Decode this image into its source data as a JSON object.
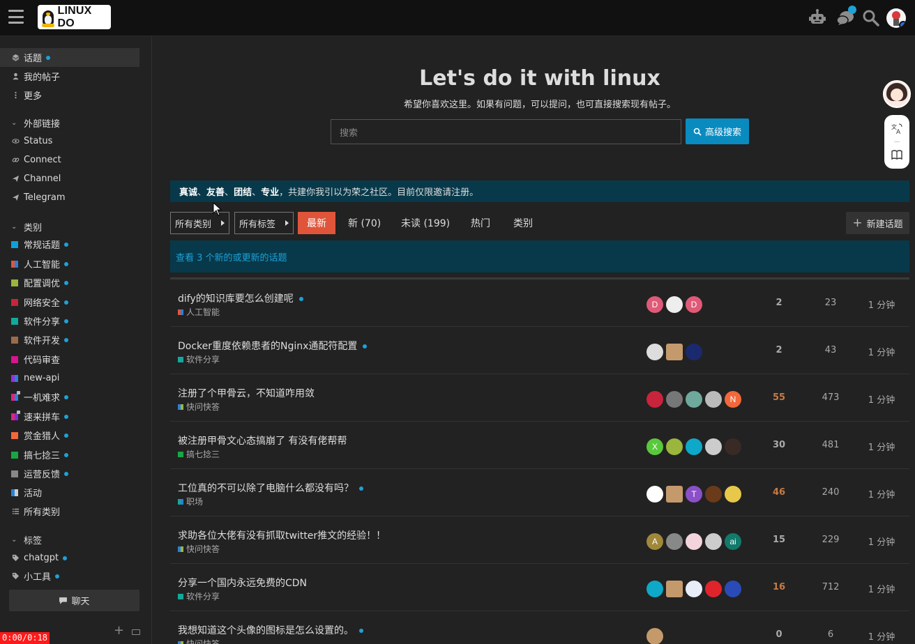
{
  "header": {
    "logo_text": "LINUX DO",
    "icons": [
      "hamburger-menu-icon",
      "robot-icon",
      "chat-bubbles-icon",
      "search-icon",
      "user-avatar"
    ],
    "accent": "#1ea1d8"
  },
  "sidebar": {
    "top_items": [
      {
        "label": "话题",
        "icon": "layers-icon",
        "dot": true,
        "active": true
      },
      {
        "label": "我的帖子",
        "icon": "user-icon",
        "dot": false
      },
      {
        "label": "更多",
        "icon": "more-vertical-icon",
        "dot": false
      }
    ],
    "external_title": "外部链接",
    "external_links": [
      {
        "label": "Status",
        "icon": "eye-icon"
      },
      {
        "label": "Connect",
        "icon": "link-icon"
      },
      {
        "label": "Channel",
        "icon": "send-icon"
      },
      {
        "label": "Telegram",
        "icon": "send-icon"
      }
    ],
    "categories_title": "类别",
    "categories": [
      {
        "label": "常规话题",
        "color": "#0e9fd8",
        "color2": "#0e9fd8",
        "dot": true
      },
      {
        "label": "人工智能",
        "color": "#e0553a",
        "color2": "#2c7fd8",
        "dot": true
      },
      {
        "label": "配置调优",
        "color": "#9ab63c",
        "color2": "#9ab63c",
        "dot": true
      },
      {
        "label": "网络安全",
        "color": "#c8243b",
        "color2": "#c8243b",
        "dot": true
      },
      {
        "label": "软件分享",
        "color": "#12a89d",
        "color2": "#12a89d",
        "dot": true
      },
      {
        "label": "软件开发",
        "color": "#9b6c4a",
        "color2": "#9b6c4a",
        "dot": true
      },
      {
        "label": "代码审查",
        "color": "#d8148f",
        "color2": "#d8148f",
        "dot": false
      },
      {
        "label": "new-api",
        "color": "#9b2fd8",
        "color2": "#2c7fd8",
        "dot": false
      },
      {
        "label": "一机难求",
        "color": "#e0247b",
        "color2": "#2c7fd8",
        "dot": true,
        "lock": true
      },
      {
        "label": "速来拼车",
        "color": "#e0247b",
        "color2": "#7b2fd8",
        "dot": true,
        "lock": true
      },
      {
        "label": "赏金猎人",
        "color": "#f2683a",
        "color2": "#f2683a",
        "dot": true
      },
      {
        "label": "搞七捻三",
        "color": "#17a844",
        "color2": "#17a844",
        "dot": true
      },
      {
        "label": "运营反馈",
        "color": "#888888",
        "color2": "#888888",
        "dot": true
      },
      {
        "label": "活动",
        "color": "#2c7fd8",
        "color2": "#cccccc",
        "dot": false
      },
      {
        "label": "所有类别",
        "color": "",
        "color2": "",
        "dot": false,
        "list": true
      }
    ],
    "tags_title": "标签",
    "tags": [
      {
        "label": "chatgpt",
        "dot": true
      },
      {
        "label": "小工具",
        "dot": true
      }
    ],
    "chat_label": "聊天",
    "timer": "0:00/0:18"
  },
  "hero": {
    "title": "Let's do it with linux",
    "subtitle": "希望你喜欢这里。如果有问题，可以提问，也可直接搜索现有帖子。",
    "search_placeholder": "搜索",
    "advanced_search": "高级搜索"
  },
  "banner": {
    "bold1": "真诚",
    "sep1": "、",
    "bold2": "友善",
    "sep2": "、",
    "bold3": "团结",
    "sep3": "、",
    "bold4": "专业",
    "rest": "，共建你我引以为荣之社区。目前仅限邀请注册。"
  },
  "nav": {
    "all_categories": "所有类别",
    "all_tags": "所有标签",
    "tabs": [
      "最新",
      "新 (70)",
      "未读 (199)",
      "热门",
      "类别"
    ],
    "new_topic": "新建话题"
  },
  "updates_text": "查看 3 个新的或更新的话题",
  "topics": [
    {
      "title": "dify的知识库要怎么创建呢",
      "unread": true,
      "category": "人工智能",
      "cat_color": "#e0553a",
      "cat_color2": "#2c7fd8",
      "posters": [
        {
          "letter": "D",
          "color": "#e05a78"
        },
        {
          "letter": "",
          "color": "#eeeeee"
        },
        {
          "letter": "D",
          "color": "#e05a78"
        }
      ],
      "replies": "2",
      "hot": false,
      "views": "23",
      "activity": "1 分钟"
    },
    {
      "title": "Docker重度依赖患者的Nginx通配符配置",
      "unread": true,
      "category": "软件分享",
      "cat_color": "#12a89d",
      "cat_color2": "#12a89d",
      "posters": [
        {
          "letter": "",
          "color": "#dddddd"
        },
        {
          "letter": "",
          "color": "#c49a6c",
          "square": true
        },
        {
          "letter": "",
          "color": "#1b2a6e"
        }
      ],
      "replies": "2",
      "hot": false,
      "views": "43",
      "activity": "1 分钟"
    },
    {
      "title": "注册了个甲骨云，不知道咋用敛",
      "unread": false,
      "category": "快问快答",
      "cat_color": "#2c7fd8",
      "cat_color2": "#9ab63c",
      "posters": [
        {
          "letter": "",
          "color": "#c8243b"
        },
        {
          "letter": "",
          "color": "#777777"
        },
        {
          "letter": "",
          "color": "#6fa89d"
        },
        {
          "letter": "",
          "color": "#bbbbbb"
        },
        {
          "letter": "N",
          "color": "#f2683a"
        }
      ],
      "replies": "55",
      "hot": true,
      "views": "473",
      "activity": "1 分钟"
    },
    {
      "title": "被注册甲骨文心态搞崩了 有没有佬帮帮",
      "unread": false,
      "category": "搞七捻三",
      "cat_color": "#17a844",
      "cat_color2": "#17a844",
      "posters": [
        {
          "letter": "X",
          "color": "#5ac83c"
        },
        {
          "letter": "",
          "color": "#9ab63c"
        },
        {
          "letter": "",
          "color": "#0ea8c8"
        },
        {
          "letter": "",
          "color": "#cccccc"
        },
        {
          "letter": "",
          "color": "#3a2a26"
        }
      ],
      "replies": "30",
      "hot": false,
      "views": "481",
      "activity": "1 分钟"
    },
    {
      "title": "工位真的不可以除了电脑什么都没有吗？",
      "unread": true,
      "category": "职场",
      "cat_color": "#12a89d",
      "cat_color2": "#2c7fd8",
      "posters": [
        {
          "letter": "",
          "color": "#ffffff"
        },
        {
          "letter": "",
          "color": "#c49a6c",
          "square": true
        },
        {
          "letter": "T",
          "color": "#8b4fc8"
        },
        {
          "letter": "",
          "color": "#6a3a1a"
        },
        {
          "letter": "",
          "color": "#e8c84a"
        }
      ],
      "replies": "46",
      "hot": true,
      "views": "240",
      "activity": "1 分钟"
    },
    {
      "title": "求助各位大佬有没有抓取twitter推文的经验！！",
      "unread": false,
      "category": "快问快答",
      "cat_color": "#2c7fd8",
      "cat_color2": "#9ab63c",
      "posters": [
        {
          "letter": "A",
          "color": "#a0883a"
        },
        {
          "letter": "",
          "color": "#888888"
        },
        {
          "letter": "",
          "color": "#f4d4dc"
        },
        {
          "letter": "",
          "color": "#cccccc"
        },
        {
          "letter": "ai",
          "color": "#127a6a"
        }
      ],
      "replies": "15",
      "hot": false,
      "views": "229",
      "activity": "1 分钟"
    },
    {
      "title": "分享一个国内永远免费的CDN",
      "unread": false,
      "category": "软件分享",
      "cat_color": "#12a89d",
      "cat_color2": "#12a89d",
      "posters": [
        {
          "letter": "",
          "color": "#0ea8c8"
        },
        {
          "letter": "",
          "color": "#c49a6c",
          "square": true
        },
        {
          "letter": "",
          "color": "#e8eef8"
        },
        {
          "letter": "",
          "color": "#e0242b"
        },
        {
          "letter": "",
          "color": "#2a4ab8"
        }
      ],
      "replies": "16",
      "hot": true,
      "views": "712",
      "activity": "1 分钟"
    },
    {
      "title": "我想知道这个头像的图标是怎么设置的。",
      "unread": true,
      "category": "快问快答",
      "cat_color": "#2c7fd8",
      "cat_color2": "#9ab63c",
      "posters": [
        {
          "letter": "",
          "color": "#c49a6c"
        }
      ],
      "replies": "0",
      "hot": false,
      "views": "6",
      "activity": "1 分钟"
    }
  ]
}
